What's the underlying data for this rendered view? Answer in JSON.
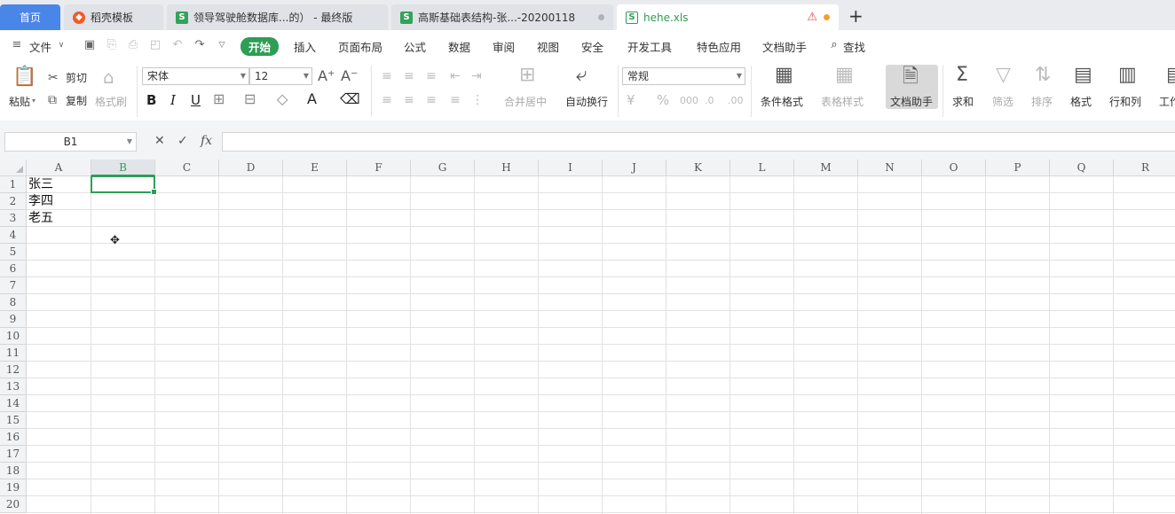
{
  "tabs": {
    "home": "首页",
    "tab1": "稻壳模板",
    "tab2": "领导驾驶舱数据库...的）  - 最终版",
    "tab3": "高斯基础表结构-张...-20200118",
    "tab4": "hehe.xls",
    "s_glyph": "S",
    "warn_icon": "warning-icon",
    "new_tab": "+"
  },
  "menubar": {
    "file": "文件",
    "items": [
      "开始",
      "插入",
      "页面布局",
      "公式",
      "数据",
      "审阅",
      "视图",
      "安全",
      "开发工具",
      "特色应用",
      "文档助手"
    ],
    "search": "查找"
  },
  "ribbon": {
    "paste": "粘贴",
    "cut": "剪切",
    "copy": "复制",
    "format_painter": "格式刷",
    "font_name": "宋体",
    "font_size": "12",
    "merge_center": "合并居中",
    "wrap_text": "自动换行",
    "number_format": "常规",
    "conditional_format": "条件格式",
    "table_style": "表格样式",
    "doc_helper": "文档助手",
    "sum": "求和",
    "filter": "筛选",
    "sort": "排序",
    "format": "格式",
    "rows_cols": "行和列",
    "worksheet": "工作"
  },
  "formula_bar": {
    "name_box": "B1",
    "fx": "fx",
    "value": ""
  },
  "sheet": {
    "columns": [
      "A",
      "B",
      "C",
      "D",
      "E",
      "F",
      "G",
      "H",
      "I",
      "J",
      "K",
      "L",
      "M",
      "N",
      "O",
      "P",
      "Q",
      "R"
    ],
    "rows": [
      "1",
      "2",
      "3",
      "4",
      "5",
      "6",
      "7",
      "8",
      "9",
      "10",
      "11",
      "12",
      "13",
      "14",
      "15",
      "16",
      "17",
      "18",
      "19",
      "20"
    ],
    "cells": {
      "A1": "张三",
      "A2": "李四",
      "A3": "老五"
    },
    "selected": "B1"
  },
  "colors": {
    "accent": "#2e9e55",
    "home_tab": "#4a86e8"
  }
}
